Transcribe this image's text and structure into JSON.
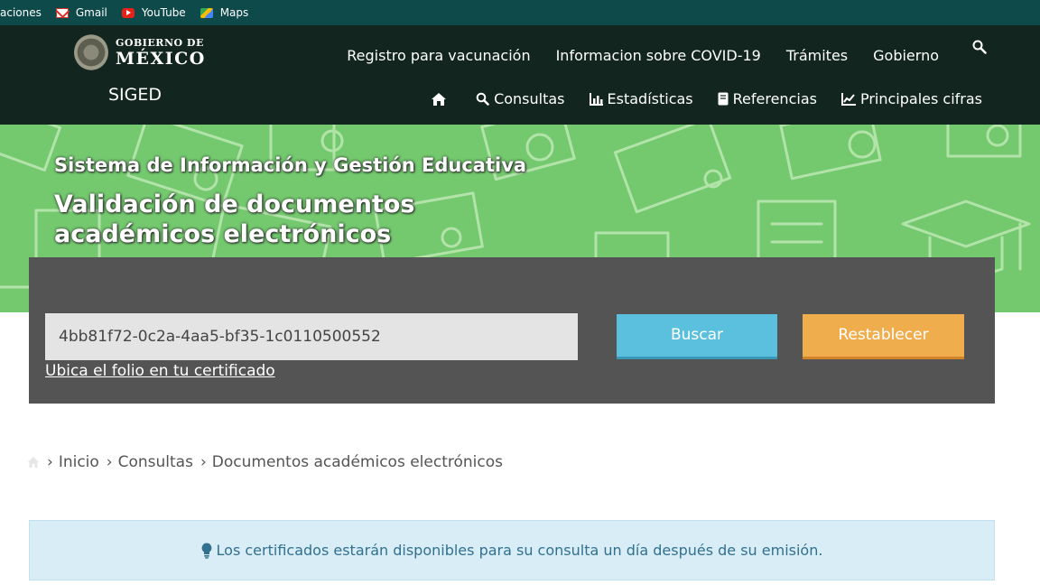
{
  "bookmarks": {
    "items": [
      {
        "label": "aciones",
        "icon": "none"
      },
      {
        "label": "Gmail",
        "icon": "gmail-icon"
      },
      {
        "label": "YouTube",
        "icon": "youtube-icon"
      },
      {
        "label": "Maps",
        "icon": "maps-icon"
      }
    ]
  },
  "header": {
    "logo": {
      "line1": "GOBIERNO DE",
      "line2": "MÉXICO"
    },
    "site_name": "SIGED",
    "top_nav": [
      "Registro para vacunación",
      "Informacion sobre COVID-19",
      "Trámites",
      "Gobierno"
    ],
    "sub_nav": [
      {
        "label": "Consultas",
        "icon": "search-icon"
      },
      {
        "label": "Estadísticas",
        "icon": "bar-chart-icon"
      },
      {
        "label": "Referencias",
        "icon": "book-icon"
      },
      {
        "label": "Principales cifras",
        "icon": "line-chart-icon"
      }
    ]
  },
  "banner": {
    "subtitle": "Sistema de Información y Gestión Educativa",
    "title": "Validación de documentos académicos electrónicos"
  },
  "search": {
    "folio_value": "4bb81f72-0c2a-4aa5-bf35-1c0110500552",
    "help_link": "Ubica el folio en tu certificado",
    "search_button": "Buscar",
    "reset_button": "Restablecer"
  },
  "breadcrumb": {
    "items": [
      "Inicio",
      "Consultas",
      "Documentos académicos electrónicos"
    ]
  },
  "alert": {
    "message": "Los certificados estarán disponibles para su consulta un día después de su emisión."
  },
  "colors": {
    "header_bg": "#12251f",
    "bookmarks_bg": "#0f4a4a",
    "banner_bg": "#74c96f",
    "panel_bg": "#545454",
    "search_button": "#5bc0de",
    "reset_button": "#f0ad4e",
    "alert_bg": "#d9edf7",
    "alert_text": "#31708f"
  }
}
